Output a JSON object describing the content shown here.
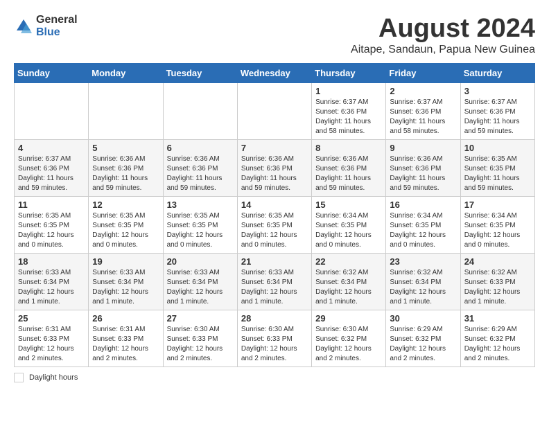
{
  "logo": {
    "general": "General",
    "blue": "Blue"
  },
  "title": {
    "month_year": "August 2024",
    "location": "Aitape, Sandaun, Papua New Guinea"
  },
  "days_of_week": [
    "Sunday",
    "Monday",
    "Tuesday",
    "Wednesday",
    "Thursday",
    "Friday",
    "Saturday"
  ],
  "weeks": [
    [
      {
        "day": "",
        "info": ""
      },
      {
        "day": "",
        "info": ""
      },
      {
        "day": "",
        "info": ""
      },
      {
        "day": "",
        "info": ""
      },
      {
        "day": "1",
        "info": "Sunrise: 6:37 AM\nSunset: 6:36 PM\nDaylight: 11 hours\nand 58 minutes."
      },
      {
        "day": "2",
        "info": "Sunrise: 6:37 AM\nSunset: 6:36 PM\nDaylight: 11 hours\nand 58 minutes."
      },
      {
        "day": "3",
        "info": "Sunrise: 6:37 AM\nSunset: 6:36 PM\nDaylight: 11 hours\nand 59 minutes."
      }
    ],
    [
      {
        "day": "4",
        "info": "Sunrise: 6:37 AM\nSunset: 6:36 PM\nDaylight: 11 hours\nand 59 minutes."
      },
      {
        "day": "5",
        "info": "Sunrise: 6:36 AM\nSunset: 6:36 PM\nDaylight: 11 hours\nand 59 minutes."
      },
      {
        "day": "6",
        "info": "Sunrise: 6:36 AM\nSunset: 6:36 PM\nDaylight: 11 hours\nand 59 minutes."
      },
      {
        "day": "7",
        "info": "Sunrise: 6:36 AM\nSunset: 6:36 PM\nDaylight: 11 hours\nand 59 minutes."
      },
      {
        "day": "8",
        "info": "Sunrise: 6:36 AM\nSunset: 6:36 PM\nDaylight: 11 hours\nand 59 minutes."
      },
      {
        "day": "9",
        "info": "Sunrise: 6:36 AM\nSunset: 6:36 PM\nDaylight: 11 hours\nand 59 minutes."
      },
      {
        "day": "10",
        "info": "Sunrise: 6:35 AM\nSunset: 6:35 PM\nDaylight: 11 hours\nand 59 minutes."
      }
    ],
    [
      {
        "day": "11",
        "info": "Sunrise: 6:35 AM\nSunset: 6:35 PM\nDaylight: 12 hours\nand 0 minutes."
      },
      {
        "day": "12",
        "info": "Sunrise: 6:35 AM\nSunset: 6:35 PM\nDaylight: 12 hours\nand 0 minutes."
      },
      {
        "day": "13",
        "info": "Sunrise: 6:35 AM\nSunset: 6:35 PM\nDaylight: 12 hours\nand 0 minutes."
      },
      {
        "day": "14",
        "info": "Sunrise: 6:35 AM\nSunset: 6:35 PM\nDaylight: 12 hours\nand 0 minutes."
      },
      {
        "day": "15",
        "info": "Sunrise: 6:34 AM\nSunset: 6:35 PM\nDaylight: 12 hours\nand 0 minutes."
      },
      {
        "day": "16",
        "info": "Sunrise: 6:34 AM\nSunset: 6:35 PM\nDaylight: 12 hours\nand 0 minutes."
      },
      {
        "day": "17",
        "info": "Sunrise: 6:34 AM\nSunset: 6:35 PM\nDaylight: 12 hours\nand 0 minutes."
      }
    ],
    [
      {
        "day": "18",
        "info": "Sunrise: 6:33 AM\nSunset: 6:34 PM\nDaylight: 12 hours\nand 1 minute."
      },
      {
        "day": "19",
        "info": "Sunrise: 6:33 AM\nSunset: 6:34 PM\nDaylight: 12 hours\nand 1 minute."
      },
      {
        "day": "20",
        "info": "Sunrise: 6:33 AM\nSunset: 6:34 PM\nDaylight: 12 hours\nand 1 minute."
      },
      {
        "day": "21",
        "info": "Sunrise: 6:33 AM\nSunset: 6:34 PM\nDaylight: 12 hours\nand 1 minute."
      },
      {
        "day": "22",
        "info": "Sunrise: 6:32 AM\nSunset: 6:34 PM\nDaylight: 12 hours\nand 1 minute."
      },
      {
        "day": "23",
        "info": "Sunrise: 6:32 AM\nSunset: 6:34 PM\nDaylight: 12 hours\nand 1 minute."
      },
      {
        "day": "24",
        "info": "Sunrise: 6:32 AM\nSunset: 6:33 PM\nDaylight: 12 hours\nand 1 minute."
      }
    ],
    [
      {
        "day": "25",
        "info": "Sunrise: 6:31 AM\nSunset: 6:33 PM\nDaylight: 12 hours\nand 2 minutes."
      },
      {
        "day": "26",
        "info": "Sunrise: 6:31 AM\nSunset: 6:33 PM\nDaylight: 12 hours\nand 2 minutes."
      },
      {
        "day": "27",
        "info": "Sunrise: 6:30 AM\nSunset: 6:33 PM\nDaylight: 12 hours\nand 2 minutes."
      },
      {
        "day": "28",
        "info": "Sunrise: 6:30 AM\nSunset: 6:33 PM\nDaylight: 12 hours\nand 2 minutes."
      },
      {
        "day": "29",
        "info": "Sunrise: 6:30 AM\nSunset: 6:32 PM\nDaylight: 12 hours\nand 2 minutes."
      },
      {
        "day": "30",
        "info": "Sunrise: 6:29 AM\nSunset: 6:32 PM\nDaylight: 12 hours\nand 2 minutes."
      },
      {
        "day": "31",
        "info": "Sunrise: 6:29 AM\nSunset: 6:32 PM\nDaylight: 12 hours\nand 2 minutes."
      }
    ]
  ],
  "legend": {
    "label": "Daylight hours"
  }
}
